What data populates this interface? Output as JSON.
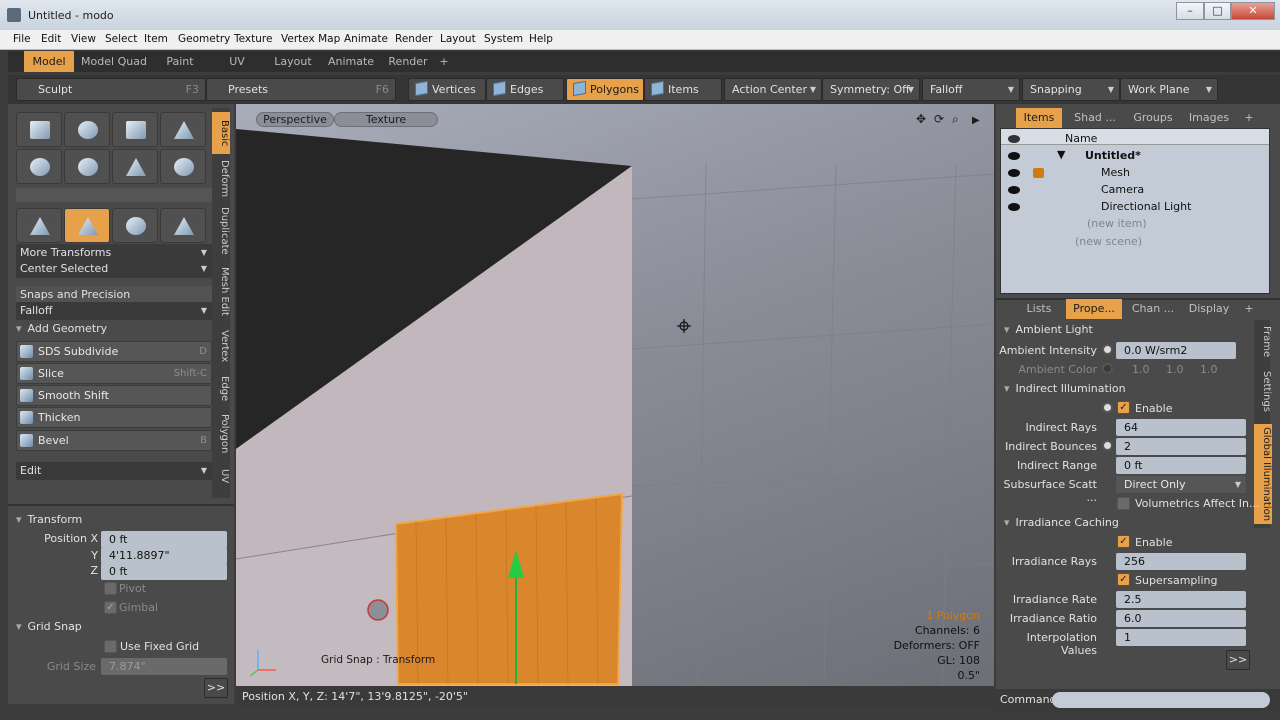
{
  "window": {
    "title": "Untitled - modo",
    "buttons": [
      "–",
      "□",
      "✕"
    ]
  },
  "menu": [
    "File",
    "Edit",
    "View",
    "Select",
    "Item",
    "Geometry",
    "Texture",
    "Vertex Map",
    "Animate",
    "Render",
    "Layout",
    "System",
    "Help"
  ],
  "layout_tabs": [
    "Model",
    "Model Quad",
    "Paint",
    "UV",
    "Layout",
    "Animate",
    "Render",
    "+"
  ],
  "toolrow": {
    "sculpt": "Sculpt",
    "sculpt_key": "F3",
    "presets": "Presets",
    "presets_key": "F6",
    "vertices": "Vertices",
    "edges": "Edges",
    "polygons": "Polygons",
    "items": "Items",
    "action_center": "Action Center",
    "symmetry": "Symmetry: Off",
    "falloff": "Falloff",
    "snapping": "Snapping",
    "work_plane": "Work Plane"
  },
  "left": {
    "vtabs": [
      "Basic",
      "Deform",
      "Duplicate",
      "Mesh Edit",
      "Vertex",
      "Edge",
      "Polygon",
      "UV"
    ],
    "more_transforms": "More Transforms",
    "center_selected": "Center Selected",
    "snaps": "Snaps and Precision",
    "falloff": "Falloff",
    "add_geometry": "Add Geometry",
    "tools": [
      {
        "label": "SDS Subdivide",
        "key": "D"
      },
      {
        "label": "Slice",
        "key": "Shift-C"
      },
      {
        "label": "Smooth Shift",
        "key": ""
      },
      {
        "label": "Thicken",
        "key": ""
      },
      {
        "label": "Bevel",
        "key": "B"
      }
    ],
    "edit": "Edit",
    "transform": {
      "title": "Transform",
      "pos_label": "Position X",
      "y_label": "Y",
      "z_label": "Z",
      "x": "0 ft",
      "y": "4'11.8897\"",
      "z": "0 ft",
      "pivot": "Pivot",
      "gimbal": "Gimbal"
    },
    "grid": {
      "title": "Grid Snap",
      "fixed": "Use Fixed Grid",
      "size_label": "Grid Size",
      "size": "7.874\""
    },
    "more_btn": ">>"
  },
  "viewport": {
    "view": "Perspective",
    "shading": "Texture",
    "overlay": "Grid Snap : Transform",
    "stats": {
      "polygons": "1 Polygon",
      "channels": "Channels: 6",
      "deformers": "Deformers: OFF",
      "gl": "GL: 108",
      "scale": "0.5\""
    },
    "accent": "#e7a14a"
  },
  "status": "Position X, Y, Z:   14'7\", 13'9.8125\", -20'5\"",
  "right": {
    "top_tabs": [
      "Items",
      "Shad ...",
      "Groups",
      "Images",
      "+"
    ],
    "col_name": "Name",
    "items": [
      "Untitled*",
      "Mesh",
      "Camera",
      "Directional Light",
      "(new item)",
      "(new scene)"
    ],
    "bottom_tabs": [
      "Lists",
      "Prope...",
      "Chan ...",
      "Display",
      "+"
    ],
    "side_tabs": [
      "Frame",
      "Settings",
      "Global Illumination"
    ],
    "props": {
      "ambient_light": "Ambient Light",
      "ambient_intensity": "Ambient Intensity",
      "ambient_intensity_val": "0.0 W/srm2",
      "ambient_color": "Ambient Color",
      "ambient_color_vals": [
        "1.0",
        "1.0",
        "1.0"
      ],
      "indirect_illum": "Indirect Illumination",
      "enable": "Enable",
      "indirect_rays": "Indirect Rays",
      "indirect_rays_val": "64",
      "indirect_bounces": "Indirect Bounces",
      "indirect_bounces_val": "2",
      "indirect_range": "Indirect Range",
      "indirect_range_val": "0 ft",
      "subsurface": "Subsurface Scatt ...",
      "subsurface_val": "Direct Only",
      "volumetrics": "Volumetrics Affect In...",
      "irr_caching": "Irradiance Caching",
      "enable2": "Enable",
      "irr_rays": "Irradiance Rays",
      "irr_rays_val": "256",
      "supersampling": "Supersampling",
      "irr_rate": "Irradiance Rate",
      "irr_rate_val": "2.5",
      "irr_ratio": "Irradiance Ratio",
      "irr_ratio_val": "6.0",
      "interp": "Interpolation Values",
      "interp_val": "1",
      "more_btn": ">>"
    },
    "command": "Command"
  }
}
